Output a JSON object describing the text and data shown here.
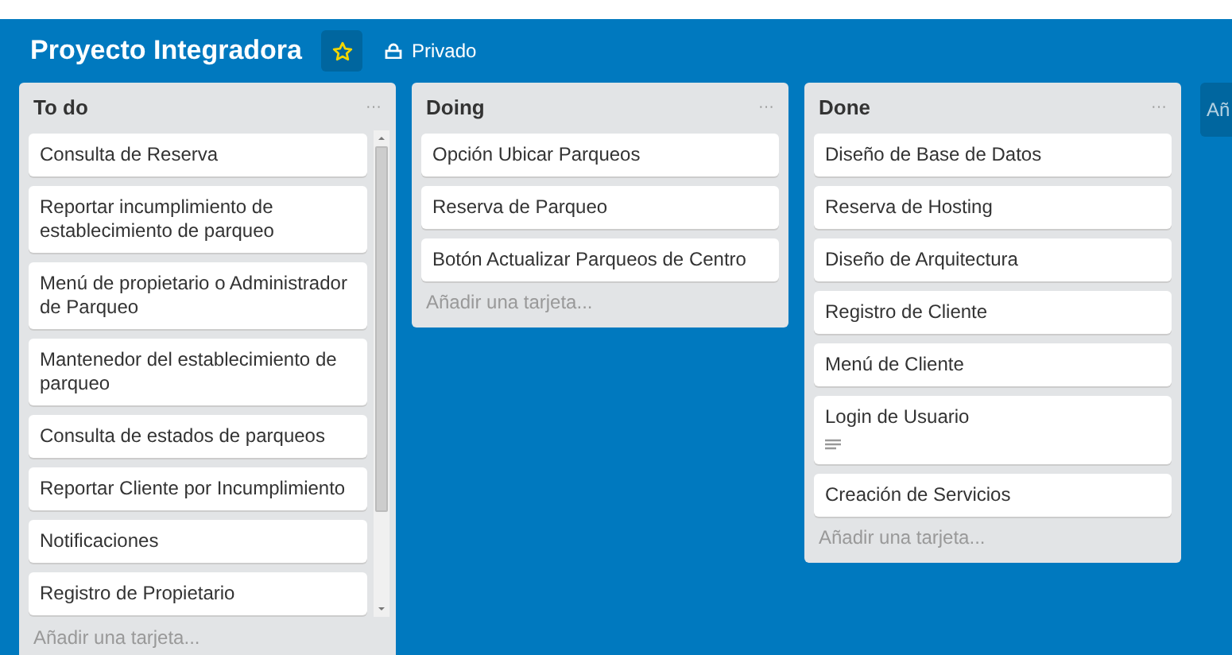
{
  "board": {
    "title": "Proyecto Integradora",
    "starred": true,
    "visibility": "Privado"
  },
  "lists": [
    {
      "title": "To do",
      "menu": "···",
      "scrollable": true,
      "cards": [
        {
          "title": "Consulta de Reserva",
          "has_description": false
        },
        {
          "title": "Reportar incumplimiento de establecimiento de parqueo",
          "has_description": false
        },
        {
          "title": "Menú de propietario o Administrador de Parqueo",
          "has_description": false
        },
        {
          "title": "Mantenedor del establecimiento de parqueo",
          "has_description": false
        },
        {
          "title": "Consulta de estados de parqueos",
          "has_description": false
        },
        {
          "title": "Reportar Cliente por Incumplimiento",
          "has_description": false
        },
        {
          "title": "Notificaciones",
          "has_description": false
        },
        {
          "title": "Registro de Propietario",
          "has_description": false
        }
      ],
      "add_card": "Añadir una tarjeta..."
    },
    {
      "title": "Doing",
      "menu": "···",
      "scrollable": false,
      "cards": [
        {
          "title": "Opción Ubicar Parqueos",
          "has_description": false
        },
        {
          "title": "Reserva de Parqueo",
          "has_description": false
        },
        {
          "title": "Botón Actualizar Parqueos de Centro",
          "has_description": false
        }
      ],
      "add_card": "Añadir una tarjeta..."
    },
    {
      "title": "Done",
      "menu": "···",
      "scrollable": false,
      "cards": [
        {
          "title": "Diseño de Base de Datos",
          "has_description": false
        },
        {
          "title": "Reserva de Hosting",
          "has_description": false
        },
        {
          "title": "Diseño de Arquitectura",
          "has_description": false
        },
        {
          "title": "Registro de Cliente",
          "has_description": false
        },
        {
          "title": "Menú de Cliente",
          "has_description": false
        },
        {
          "title": "Login de Usuario",
          "has_description": true
        },
        {
          "title": "Creación de Servicios",
          "has_description": false
        }
      ],
      "add_card": "Añadir una tarjeta..."
    }
  ],
  "add_list": "Añ"
}
